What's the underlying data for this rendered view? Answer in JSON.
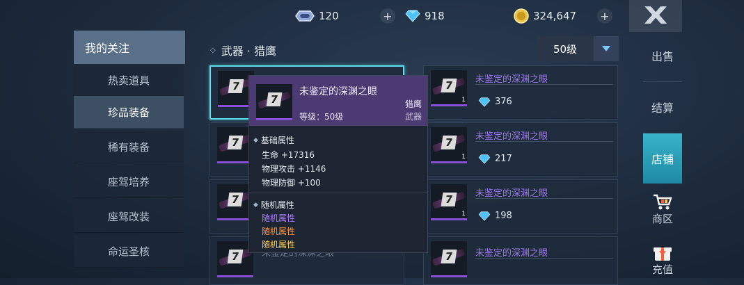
{
  "currency": {
    "tickets": "120",
    "diamonds": "918",
    "gold": "324,647",
    "plus_label": "+"
  },
  "close_label": "X",
  "categories": {
    "header": "我的关注",
    "items": [
      {
        "label": "热卖道具"
      },
      {
        "label": "珍品装备"
      },
      {
        "label": "稀有装备"
      },
      {
        "label": "座驾培养"
      },
      {
        "label": "座驾改装"
      },
      {
        "label": "命运圣核"
      }
    ],
    "active_index": 1
  },
  "breadcrumb": "武器 · 猎鹰",
  "level_select": {
    "value": "50级"
  },
  "items": [
    {
      "name": "未鉴定的深渊之眼",
      "price": "376",
      "count": "1"
    },
    {
      "name": "未鉴定的深渊之眼",
      "price": "217",
      "count": "1"
    },
    {
      "name": "未鉴定的深渊之眼",
      "price": "198",
      "count": "1"
    }
  ],
  "tooltip": {
    "title": "未鉴定的深渊之眼",
    "type": "猎鹰",
    "category": "武器",
    "level": "等级：50级",
    "base_header": "基础属性",
    "base_stats": [
      "生命 +17316",
      "物理攻击 +1146",
      "物理防御 +100"
    ],
    "random_header": "随机属性",
    "random_stats": [
      {
        "text": "随机属性",
        "color": "#b07cff"
      },
      {
        "text": "随机属性",
        "color": "#ff9a3c"
      },
      {
        "text": "随机属性",
        "color": "#ffd24a"
      }
    ],
    "partial_name": "未鉴定的深渊之眼"
  },
  "right_nav": {
    "items": [
      {
        "label": "出售"
      },
      {
        "label": "结算"
      },
      {
        "label": "店铺"
      },
      {
        "label": "商区"
      },
      {
        "label": "充值"
      }
    ],
    "active_index": 2
  },
  "colors": {
    "accent_cyan": "#37b3c9",
    "tooltip_header": "#4b3b72",
    "item_name": "#9b78e8"
  }
}
